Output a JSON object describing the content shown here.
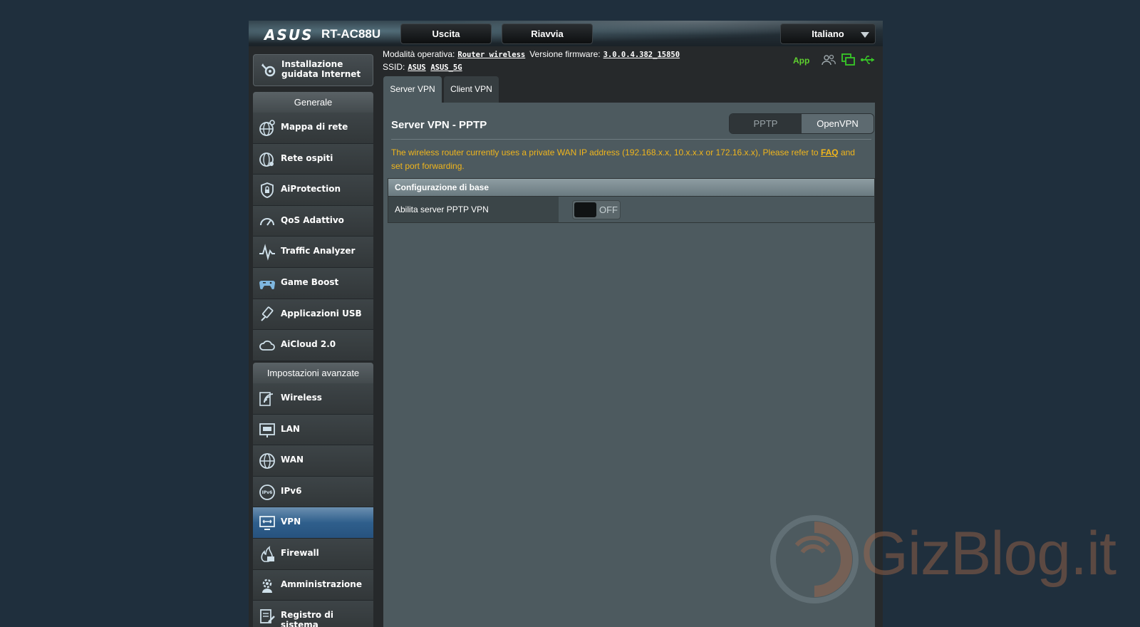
{
  "header": {
    "logo": "ASUS",
    "model": "RT-AC88U",
    "exit_label": "Uscita",
    "reboot_label": "Riavvia",
    "language": "Italiano"
  },
  "status": {
    "mode_label": "Modalità operativa:",
    "mode_value": "Router wireless",
    "fw_label": "Versione firmware:",
    "fw_value": "3.0.0.4.382_15850",
    "ssid_label": "SSID:",
    "ssid_1": "ASUS",
    "ssid_2": "ASUS_5G",
    "app_label": "App"
  },
  "quick_setup": {
    "label_line1": "Installazione",
    "label_line2": "guidata Internet"
  },
  "menu_general": {
    "title": "Generale",
    "items": [
      {
        "label": "Mappa di rete"
      },
      {
        "label": "Rete ospiti"
      },
      {
        "label": "AiProtection"
      },
      {
        "label": "QoS Adattivo"
      },
      {
        "label": "Traffic Analyzer"
      },
      {
        "label": "Game Boost"
      },
      {
        "label": "Applicazioni USB"
      },
      {
        "label": "AiCloud 2.0"
      }
    ]
  },
  "menu_advanced": {
    "title": "Impostazioni avanzate",
    "items": [
      {
        "label": "Wireless"
      },
      {
        "label": "LAN"
      },
      {
        "label": "WAN"
      },
      {
        "label": "IPv6"
      },
      {
        "label": "VPN",
        "active": true
      },
      {
        "label": "Firewall"
      },
      {
        "label": "Amministrazione"
      },
      {
        "label": "Registro di sistema"
      }
    ]
  },
  "tabs": [
    {
      "label": "Server VPN",
      "active": true
    },
    {
      "label": "Client VPN"
    }
  ],
  "content": {
    "title": "Server VPN - PPTP",
    "switch_pptp": "PPTP",
    "switch_openvpn": "OpenVPN",
    "note_text": "The wireless router currently uses a private WAN IP address (192.168.x.x, 10.x.x.x or 172.16.x.x), Please refer to ",
    "note_link": "FAQ",
    "note_tail": " and set port forwarding.",
    "config_header": "Configurazione di base",
    "config_row_label": "Abilita server PPTP VPN",
    "toggle_state": "OFF"
  },
  "watermark": "GizBlog.it",
  "colors": {
    "accent_orange": "#f0b51c",
    "active_blue": "#2f5f8c",
    "status_green": "#5fd12f"
  }
}
